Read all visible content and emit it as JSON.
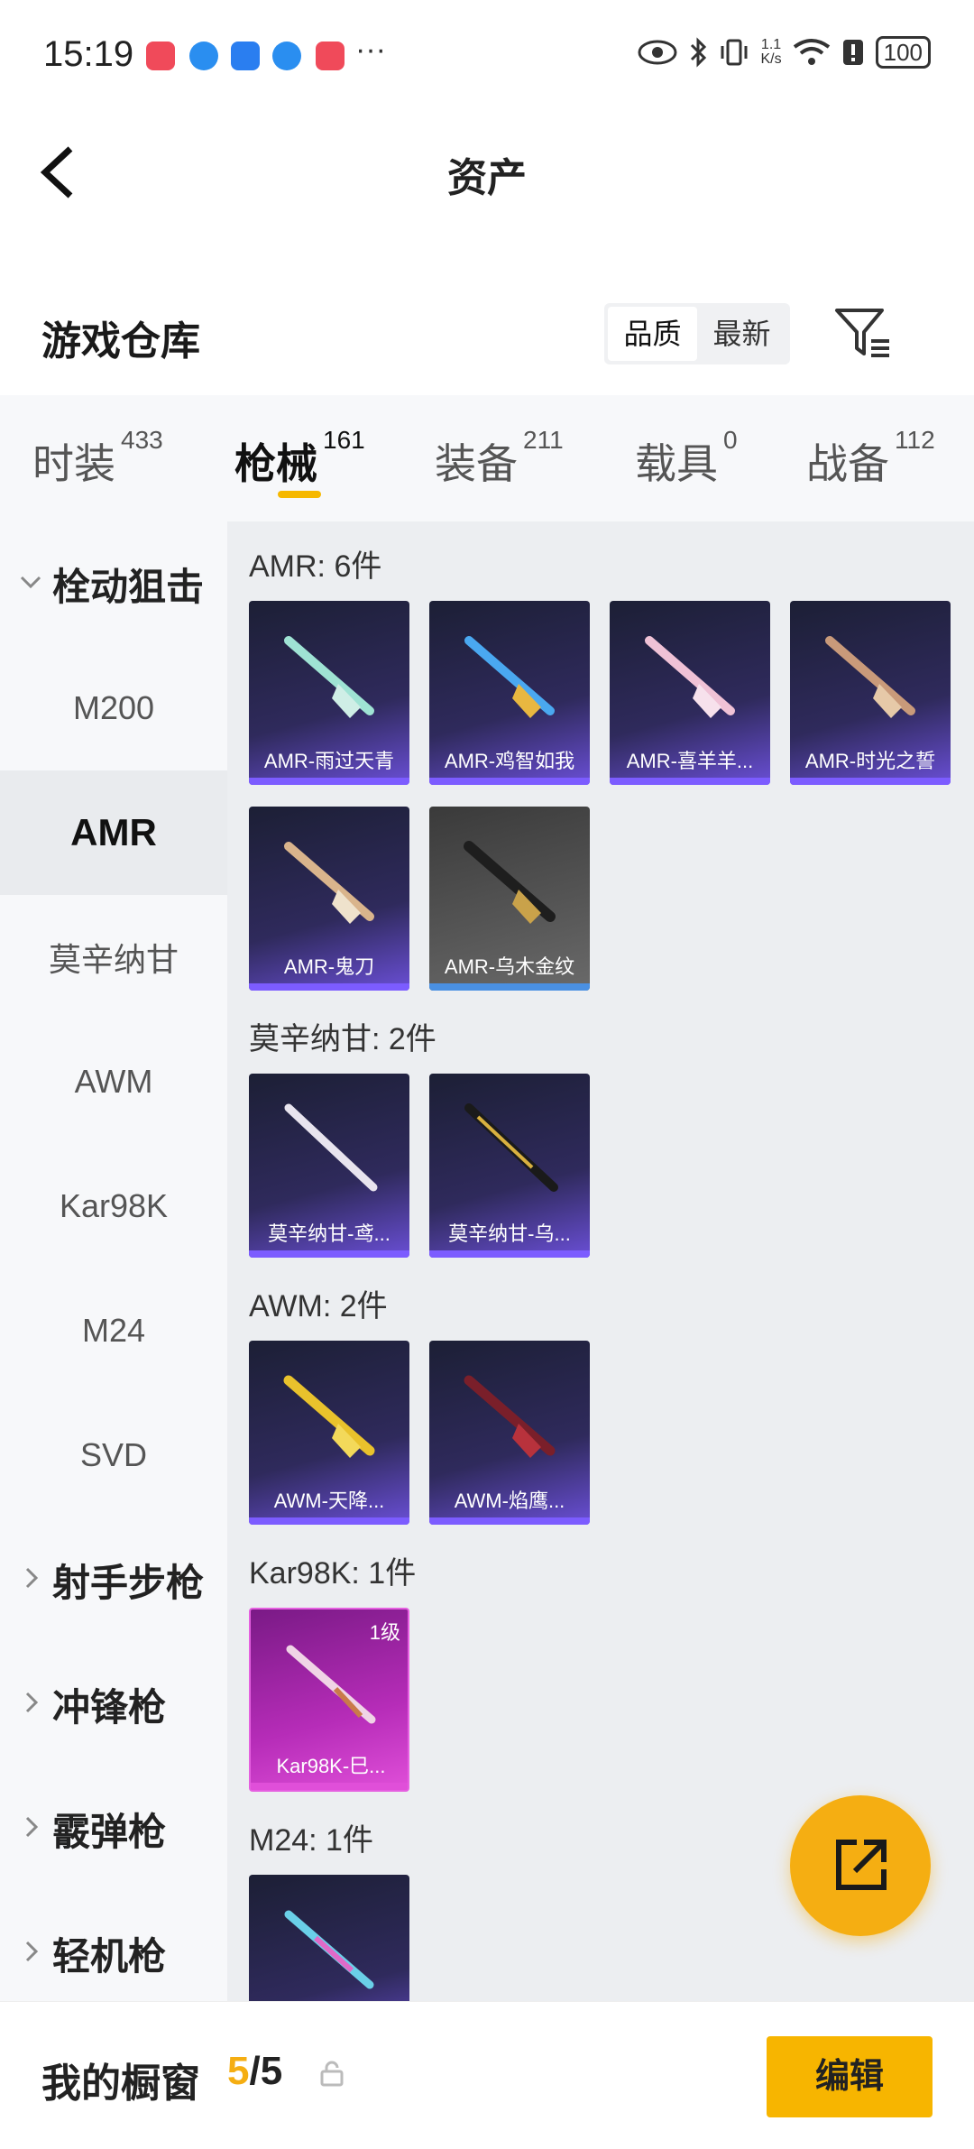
{
  "status_bar": {
    "time": "15:19",
    "dots": "···",
    "net_speed_top": "1.1",
    "net_speed_bottom": "K/s",
    "battery": "100"
  },
  "nav": {
    "title": "资产"
  },
  "warehouse": {
    "title": "游戏仓库",
    "sort_options": [
      "品质",
      "最新"
    ],
    "active_sort": "品质"
  },
  "tabs": [
    {
      "label": "时装",
      "count": "433"
    },
    {
      "label": "枪械",
      "count": "161"
    },
    {
      "label": "装备",
      "count": "211"
    },
    {
      "label": "载具",
      "count": "0"
    },
    {
      "label": "战备",
      "count": "112"
    }
  ],
  "active_tab": "枪械",
  "sidebar": {
    "items": [
      {
        "label": "栓动狙击",
        "type": "group-open"
      },
      {
        "label": "M200"
      },
      {
        "label": "AMR",
        "selected": true
      },
      {
        "label": "莫辛纳甘"
      },
      {
        "label": "AWM"
      },
      {
        "label": "Kar98K"
      },
      {
        "label": "M24"
      },
      {
        "label": "SVD"
      },
      {
        "label": "射手步枪",
        "type": "group"
      },
      {
        "label": "冲锋枪",
        "type": "group"
      },
      {
        "label": "霰弹枪",
        "type": "group"
      },
      {
        "label": "轻机枪",
        "type": "group"
      }
    ]
  },
  "sections": [
    {
      "title": "AMR: 6件",
      "items": [
        "AMR-雨过天青",
        "AMR-鸡智如我",
        "AMR-喜羊羊...",
        "AMR-时光之誓",
        "AMR-鬼刀",
        "AMR-乌木金纹"
      ]
    },
    {
      "title": "莫辛纳甘: 2件",
      "items": [
        "莫辛纳甘-鸢...",
        "莫辛纳甘-乌..."
      ]
    },
    {
      "title": "AWM: 2件",
      "items": [
        "AWM-天降...",
        "AWM-焰鹰..."
      ]
    },
    {
      "title": "Kar98K: 1件",
      "items": [
        "Kar98K-巳..."
      ],
      "level": "1级"
    },
    {
      "title": "M24: 1件",
      "items": [
        ""
      ]
    }
  ],
  "bottom": {
    "title": "我的橱窗",
    "count_current": "5",
    "count_sep": "/",
    "count_total": "5",
    "edit_label": "编辑"
  },
  "colors": {
    "accent": "#f5ae12",
    "card_purple": "#6a4fd6",
    "card_pink": "#e04fd9",
    "card_grey_bar": "#4a90e2"
  }
}
